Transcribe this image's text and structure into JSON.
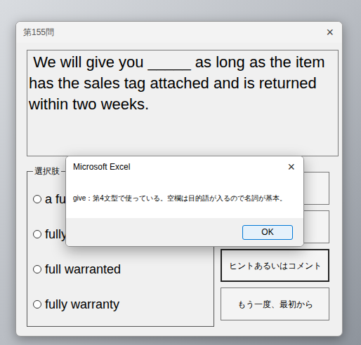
{
  "window": {
    "title": "第155問",
    "close": "×"
  },
  "question": "We will give you _____ as long as the item has the sales tag attached and is returned within two weeks.",
  "choices": {
    "label": "選択肢",
    "options": [
      {
        "label": "a fu",
        "selected": false
      },
      {
        "label": "fully",
        "selected": false
      },
      {
        "label": "full warranted",
        "selected": false
      },
      {
        "label": "fully warranty",
        "selected": false
      }
    ]
  },
  "buttons": [
    {
      "label": "",
      "focused": false
    },
    {
      "label": "",
      "focused": false
    },
    {
      "label": "ヒントあるいはコメント",
      "focused": true
    },
    {
      "label": "もう一度、最初から",
      "focused": false
    }
  ],
  "message_box": {
    "title": "Microsoft Excel",
    "close": "×",
    "message": "give：第4文型で使っている。空欄は目的語が入るので名詞が基本。",
    "buttons": [
      "OK"
    ]
  }
}
